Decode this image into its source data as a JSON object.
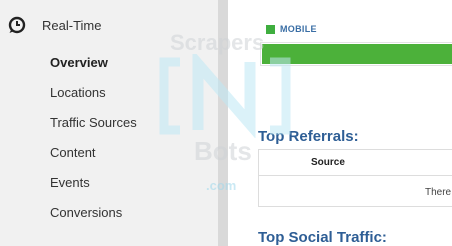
{
  "sidebar": {
    "section": {
      "label": "Real-Time",
      "icon": "clock-icon"
    },
    "items": [
      {
        "label": "Overview",
        "active": true
      },
      {
        "label": "Locations",
        "active": false
      },
      {
        "label": "Traffic Sources",
        "active": false
      },
      {
        "label": "Content",
        "active": false
      },
      {
        "label": "Events",
        "active": false
      },
      {
        "label": "Conversions",
        "active": false
      }
    ]
  },
  "main": {
    "legend_label": "MOBILE",
    "legend_color": "#3fae3f",
    "top_referrals": {
      "heading": "Top Referrals:",
      "column": "Source",
      "empty_text": "There"
    },
    "top_social_heading": "Top Social Traffic:"
  },
  "watermark": {
    "line1": "Scrapers",
    "line2": "Bots",
    "line3": ".com"
  }
}
